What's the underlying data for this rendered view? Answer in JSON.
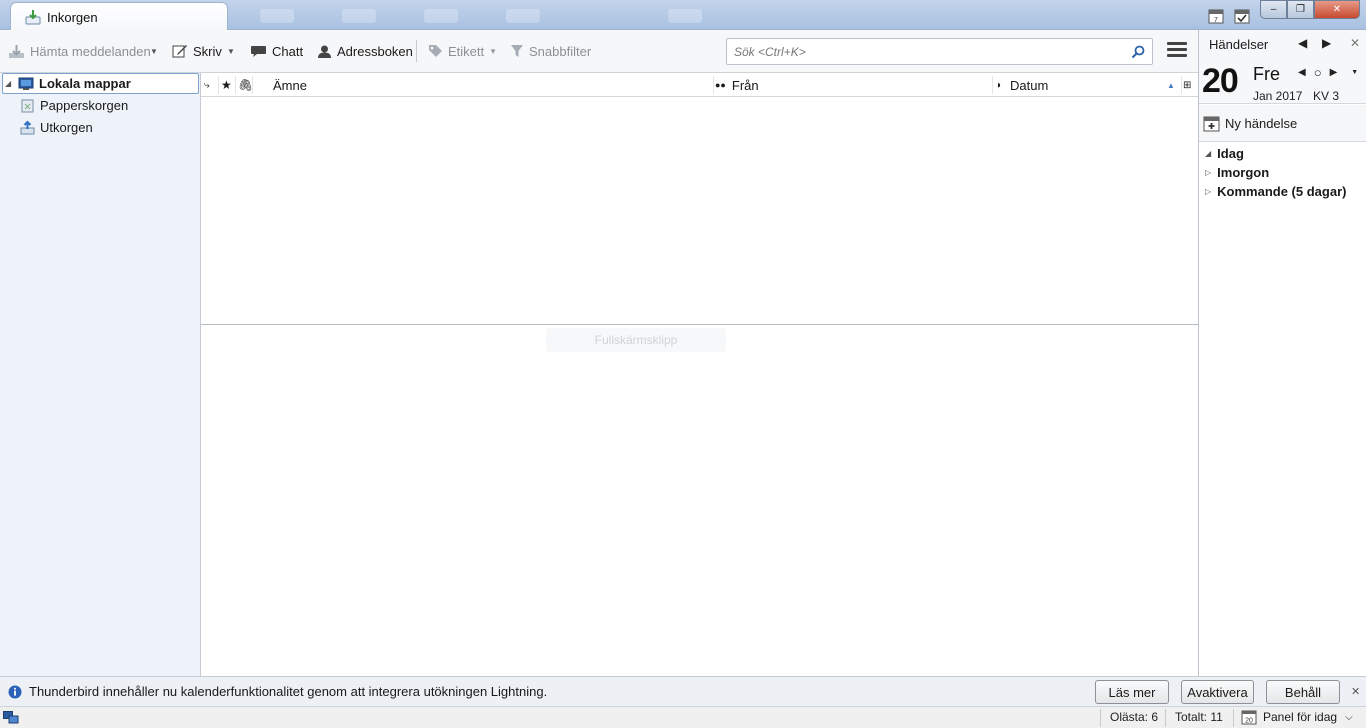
{
  "tab": {
    "label": "Inkorgen"
  },
  "window_controls": {
    "minimize": "–",
    "restore": "❐",
    "close": "✕"
  },
  "toolbar": {
    "get_messages": "Hämta meddelanden",
    "write": "Skriv",
    "chat": "Chatt",
    "address_book": "Adressboken",
    "tag": "Etikett",
    "quick_filter": "Snabbfilter"
  },
  "search": {
    "placeholder": "Sök <Ctrl+K>"
  },
  "folders": {
    "root": "Lokala mappar",
    "items": [
      {
        "label": "Papperskorgen",
        "icon": "trash-icon"
      },
      {
        "label": "Utkorgen",
        "icon": "outbox-icon"
      }
    ]
  },
  "thread_columns": {
    "subject": "Ämne",
    "from": "Från",
    "date": "Datum"
  },
  "message_pane": {
    "ghost_text": "Fullskärmsklipp"
  },
  "today_pane": {
    "title": "Händelser",
    "day_number": "20",
    "day_name": "Fre",
    "month_year": "Jan 2017",
    "week": "KV 3",
    "new_event": "Ny händelse",
    "agenda": [
      {
        "label": "Idag",
        "expanded": true
      },
      {
        "label": "Imorgon",
        "expanded": false
      },
      {
        "label": "Kommande (5 dagar)",
        "expanded": false
      }
    ]
  },
  "notification": {
    "text": "Thunderbird innehåller nu kalenderfunktionalitet genom att integrera utökningen Lightning.",
    "learn_more": "Läs mer",
    "disable": "Avaktivera",
    "keep": "Behåll"
  },
  "status": {
    "unread": "Olästa: 6",
    "total": "Totalt: 11",
    "today_panel": "Panel för idag"
  },
  "colors": {
    "titlebar": "#b3c8e4",
    "folder_pane": "#eef3fa",
    "selection_border": "#7da2ce"
  }
}
